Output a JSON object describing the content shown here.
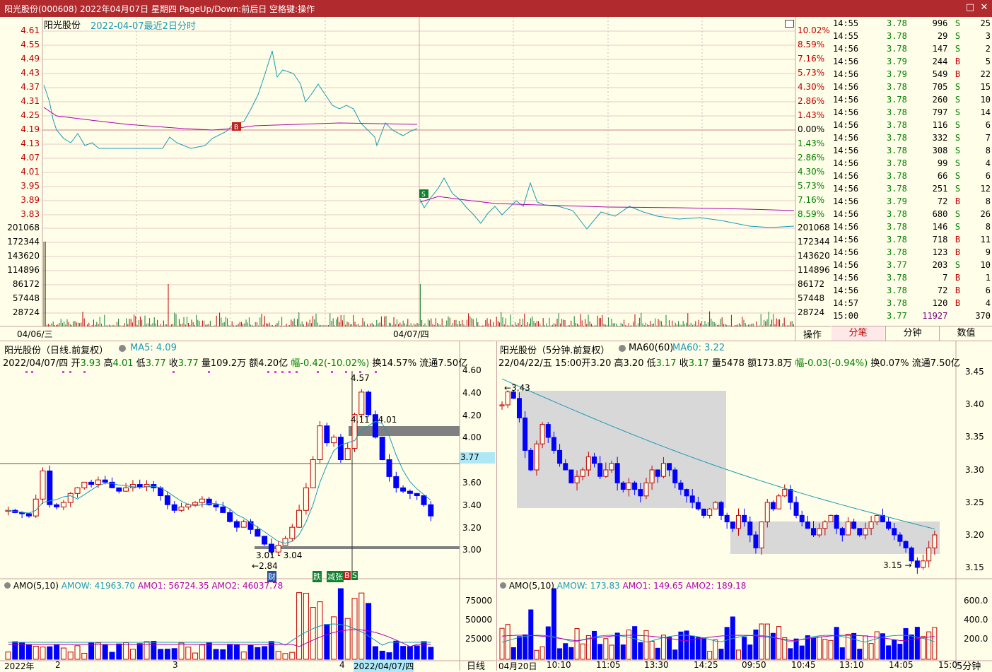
{
  "window": {
    "title": "阳光股份(000608) 2022年04月07日 星期四 PageUp/Down:前后日 空格键:操作",
    "min_label": "□",
    "close_label": "✕"
  },
  "colors": {
    "up": "#c00000",
    "down": "#0000ff",
    "ma": "#1a9ab5",
    "avg": "#b000b0",
    "grid": "#c8a0a0"
  },
  "intraday": {
    "name": "阳光股份",
    "subtitle": "2022-04-07最近2日分时",
    "price_ticks": [
      "4.61",
      "4.55",
      "4.49",
      "4.43",
      "4.37",
      "4.31",
      "4.25",
      "4.19",
      "4.13",
      "4.07",
      "4.01",
      "3.95",
      "3.89",
      "3.83"
    ],
    "pct_ticks": [
      "10.02%",
      "8.59%",
      "7.16%",
      "5.73%",
      "4.30%",
      "2.86%",
      "1.43%",
      "0.00%",
      "1.43%",
      "2.86%",
      "4.30%",
      "5.73%",
      "7.16%",
      "8.59%"
    ],
    "vol_ticks": [
      "201068",
      "172344",
      "143620",
      "114896",
      "86172",
      "57448",
      "28724"
    ],
    "date_labels": [
      "04/06/三",
      "04/07/四"
    ],
    "markers": {
      "buy": "B",
      "sell": "S"
    },
    "ops_label": "操作"
  },
  "trades": {
    "rows": [
      [
        "14:55",
        "3.78",
        "996",
        "S",
        "25"
      ],
      [
        "14:55",
        "3.78",
        "29",
        "S",
        "3"
      ],
      [
        "14:56",
        "3.78",
        "147",
        "S",
        "2"
      ],
      [
        "14:56",
        "3.79",
        "244",
        "B",
        "5"
      ],
      [
        "14:56",
        "3.79",
        "549",
        "B",
        "22"
      ],
      [
        "14:56",
        "3.78",
        "705",
        "S",
        "15"
      ],
      [
        "14:56",
        "3.78",
        "260",
        "S",
        "10"
      ],
      [
        "14:56",
        "3.78",
        "797",
        "S",
        "14"
      ],
      [
        "14:56",
        "3.78",
        "116",
        "S",
        "6"
      ],
      [
        "14:56",
        "3.78",
        "332",
        "S",
        "7"
      ],
      [
        "14:56",
        "3.78",
        "308",
        "S",
        "8"
      ],
      [
        "14:56",
        "3.78",
        "99",
        "S",
        "4"
      ],
      [
        "14:56",
        "3.78",
        "66",
        "S",
        "6"
      ],
      [
        "14:56",
        "3.78",
        "251",
        "S",
        "12"
      ],
      [
        "14:56",
        "3.79",
        "72",
        "B",
        "8"
      ],
      [
        "14:56",
        "3.78",
        "680",
        "S",
        "26"
      ],
      [
        "14:56",
        "3.78",
        "146",
        "S",
        "8"
      ],
      [
        "14:56",
        "3.78",
        "718",
        "B",
        "11"
      ],
      [
        "14:56",
        "3.78",
        "123",
        "B",
        "9"
      ],
      [
        "14:56",
        "3.77",
        "203",
        "S",
        "10"
      ],
      [
        "14:56",
        "3.78",
        "7",
        "B",
        "1"
      ],
      [
        "14:56",
        "3.78",
        "72",
        "B",
        "6"
      ],
      [
        "14:57",
        "3.78",
        "120",
        "B",
        "4"
      ],
      [
        "15:00",
        "3.77",
        "11927",
        "",
        "370"
      ]
    ],
    "tabs": [
      "分笔",
      "分钟",
      "数值"
    ]
  },
  "daily": {
    "header": "阳光股份（日线.前复权）",
    "ma_label": "MA5: 4.09",
    "info": {
      "date": "2022/04/07/四",
      "open_k": "开",
      "open_v": "3.93",
      "high_k": "高",
      "high_v": "4.01",
      "low_k": "低",
      "low_v": "3.77",
      "close_k": "收",
      "close_v": "3.77",
      "vol": "量109.2万",
      "amt": "额4.20亿",
      "chg": "幅-0.42(-10.02%)",
      "turn": "换14.57%",
      "float": "流通7.50亿"
    },
    "y_ticks": [
      "4.60",
      "4.40",
      "4.20",
      "4.00",
      "3.80",
      "3.60",
      "3.40",
      "3.20",
      "3.00"
    ],
    "current": "3.77",
    "ann": {
      "high": "4.57",
      "range1": "4.11 - 4.01",
      "range2": "3.01 - 3.04",
      "low": "2.84",
      "tag_cai": "财",
      "tag_die": "跌",
      "tag_zhang": "减张",
      "tag_b": "B",
      "tag_s": "S"
    },
    "amo_header": {
      "a": "AMO(5,10)",
      "b": "AMOW: 41963.70",
      "c": "AMO1: 56724.35",
      "d": "AMO2: 46037.78"
    },
    "amo_ticks": [
      "75000",
      "50000",
      "25000"
    ],
    "x_labels": [
      "2022年",
      "2",
      "3",
      "4",
      "2022/04/07/四"
    ],
    "period": "日线"
  },
  "m5": {
    "header": "阳光股份（5分钟.前复权）",
    "ma_label": "MA60(60)",
    "ma_val": "MA60: 3.22",
    "info": {
      "date": "22/04/22/五",
      "time": "15:00",
      "open_k": "开",
      "open_v": "3.20",
      "high_k": "高",
      "high_v": "3.20",
      "low_k": "低",
      "low_v": "3.17",
      "close_k": "收",
      "close_v": "3.17",
      "vol": "量5478",
      "amt": "额173.8万",
      "chg": "幅-0.03(-0.94%)",
      "turn": "换0.07%",
      "float": "流通7.50亿"
    },
    "y_ticks": [
      "3.45",
      "3.40",
      "3.35",
      "3.30",
      "3.25",
      "3.20",
      "3.15"
    ],
    "ann": {
      "high": "3.43",
      "low": "3.15"
    },
    "amo_header": {
      "a": "AMO(5,10)",
      "b": "AMOW: 173.83",
      "c": "AMO1: 149.65",
      "d": "AMO2: 189.18"
    },
    "amo_ticks": [
      "600.0",
      "400.0",
      "200.0"
    ],
    "x_labels": [
      "04月20日",
      "10:10",
      "11:05",
      "13:30",
      "14:25",
      "09:50",
      "10:45",
      "13:10",
      "14:05",
      "15:0"
    ],
    "period": "5分钟"
  }
}
